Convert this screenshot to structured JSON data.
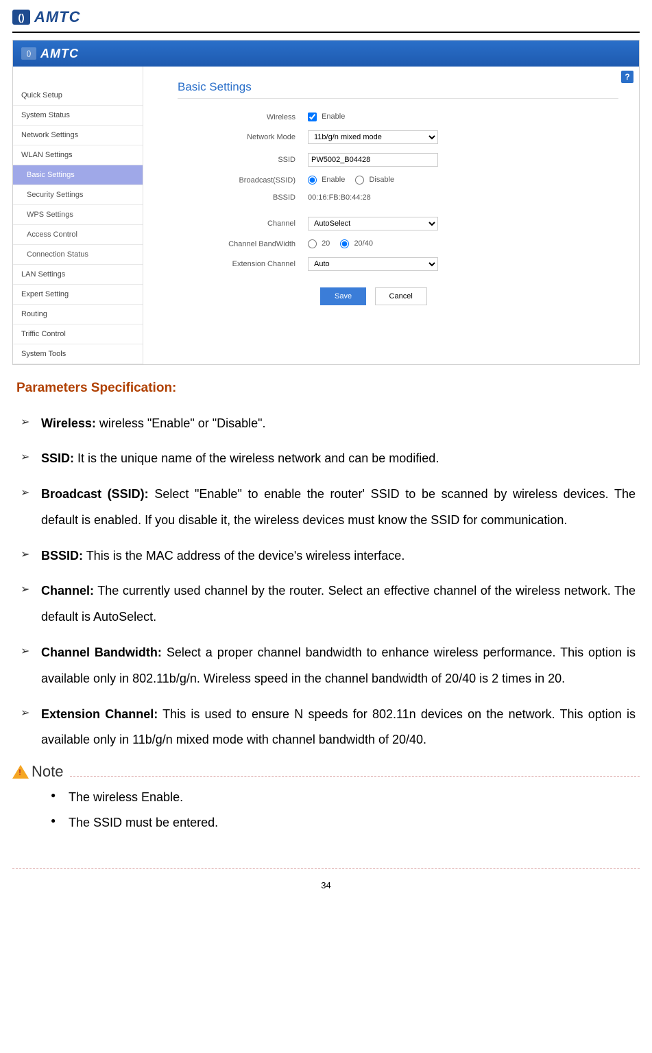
{
  "brand": "AMTC",
  "screenshot": {
    "brand": "AMTC",
    "help_icon": "?",
    "sidebar": [
      {
        "label": "Quick Setup",
        "type": "item"
      },
      {
        "label": "System Status",
        "type": "item"
      },
      {
        "label": "Network Settings",
        "type": "item"
      },
      {
        "label": "WLAN Settings",
        "type": "item"
      },
      {
        "label": "Basic Settings",
        "type": "sub-active"
      },
      {
        "label": "Security Settings",
        "type": "sub"
      },
      {
        "label": "WPS Settings",
        "type": "sub"
      },
      {
        "label": "Access Control",
        "type": "sub"
      },
      {
        "label": "Connection Status",
        "type": "sub"
      },
      {
        "label": "LAN Settings",
        "type": "item"
      },
      {
        "label": "Expert Setting",
        "type": "item"
      },
      {
        "label": "Routing",
        "type": "item"
      },
      {
        "label": "Triffic Control",
        "type": "item"
      },
      {
        "label": "System Tools",
        "type": "item"
      }
    ],
    "contentTitle": "Basic Settings",
    "form": {
      "wireless": {
        "label": "Wireless",
        "enable": "Enable",
        "checked": true
      },
      "networkMode": {
        "label": "Network Mode",
        "value": "11b/g/n mixed mode"
      },
      "ssid": {
        "label": "SSID",
        "value": "PW5002_B04428"
      },
      "broadcast": {
        "label": "Broadcast(SSID)",
        "enable": "Enable",
        "disable": "Disable",
        "selected": "enable"
      },
      "bssid": {
        "label": "BSSID",
        "value": "00:16:FB:B0:44:28"
      },
      "channel": {
        "label": "Channel",
        "value": "AutoSelect"
      },
      "bandwidth": {
        "label": "Channel BandWidth",
        "opt20": "20",
        "opt2040": "20/40",
        "selected": "2040"
      },
      "extChannel": {
        "label": "Extension Channel",
        "value": "Auto"
      }
    },
    "buttons": {
      "save": "Save",
      "cancel": "Cancel"
    }
  },
  "doc": {
    "heading": "Parameters Specification:",
    "params": [
      {
        "term": "Wireless:",
        "desc": " wireless \"Enable\" or \"Disable\"."
      },
      {
        "term": "SSID:",
        "desc": " It is the unique name of the wireless network and can be modified."
      },
      {
        "term": "Broadcast (SSID):",
        "desc": " Select \"Enable\" to enable the router' SSID to be scanned by wireless devices. The default is enabled. If you disable it, the wireless devices must know the SSID for communication."
      },
      {
        "term": "BSSID:",
        "desc": " This is the MAC address of the device's wireless interface."
      },
      {
        "term": "Channel:",
        "desc": " The currently used channel by the router. Select an effective channel of the wireless network. The default is AutoSelect."
      },
      {
        "term": "Channel Bandwidth:",
        "desc": " Select a proper channel bandwidth to enhance wireless performance. This option is available only in 802.11b/g/n. Wireless speed in the channel bandwidth of 20/40 is 2 times in 20."
      },
      {
        "term": "Extension Channel:",
        "desc": " This is used to ensure N speeds for 802.11n devices on the network. This option is available only in 11b/g/n mixed mode with channel bandwidth of 20/40."
      }
    ],
    "noteLabel": "Note",
    "notes": [
      "The wireless Enable.",
      "The SSID must be entered."
    ]
  },
  "pageNumber": "34"
}
